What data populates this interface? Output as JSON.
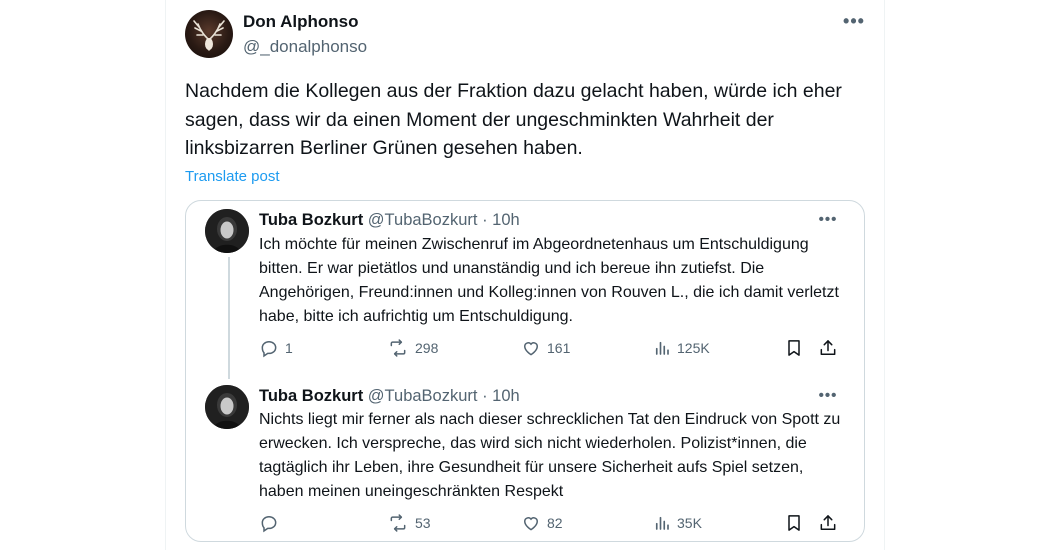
{
  "post": {
    "author_name": "Don Alphonso",
    "author_handle": "@_donalphonso",
    "more_glyph": "•••",
    "text": "Nachdem die Kollegen aus der Fraktion dazu gelacht  haben, würde ich eher sagen, dass wir da einen Moment der ungeschminkten Wahrheit der linksbizarren Berliner Grünen gesehen haben.",
    "translate_label": "Translate post"
  },
  "quotes": [
    {
      "name": "Tuba Bozkurt",
      "handle": "@TubaBozkurt",
      "separator": "·",
      "time": "10h",
      "more_glyph": "•••",
      "text": "Ich möchte für meinen Zwischenruf im Abgeordnetenhaus um Entschuldigung bitten. Er war pietätlos und unanständig und ich bereue ihn zutiefst. Die Angehörigen, Freund:innen und Kolleg:innen von Rouven L., die ich damit verletzt habe, bitte ich aufrichtig um Entschuldigung.",
      "replies": "1",
      "reposts": "298",
      "likes": "161",
      "views": "125K"
    },
    {
      "name": "Tuba Bozkurt",
      "handle": "@TubaBozkurt",
      "separator": "·",
      "time": "10h",
      "more_glyph": "•••",
      "text": "Nichts liegt mir ferner als nach dieser schrecklichen Tat den Eindruck von Spott zu erwecken. Ich verspreche, das wird sich nicht wiederholen. Polizist*innen, die tagtäglich ihr Leben, ihre Gesundheit für unsere Sicherheit aufs Spiel setzen, haben meinen uneingeschränkten Respekt",
      "replies": "",
      "reposts": "53",
      "likes": "82",
      "views": "35K"
    }
  ],
  "icons": {
    "reply": "reply-icon",
    "repost": "repost-icon",
    "like": "like-icon",
    "views": "views-icon",
    "bookmark": "bookmark-icon",
    "share": "share-icon"
  },
  "colors": {
    "text": "#0f1419",
    "secondary": "#536471",
    "link": "#1d9bf0",
    "border": "#cfd9de"
  }
}
